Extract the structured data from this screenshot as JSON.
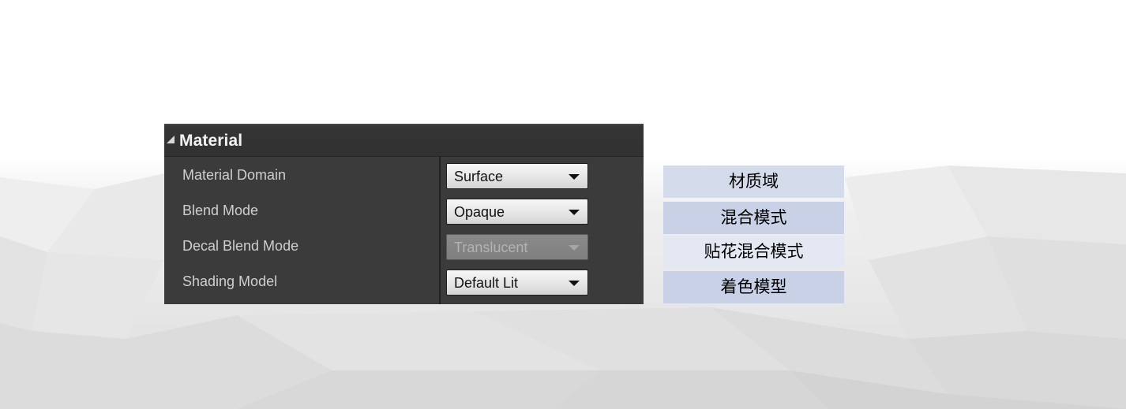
{
  "panel": {
    "title": "Material",
    "properties": [
      {
        "label": "Material Domain",
        "value": "Surface",
        "enabled": true
      },
      {
        "label": "Blend Mode",
        "value": "Opaque",
        "enabled": true
      },
      {
        "label": "Decal Blend Mode",
        "value": "Translucent",
        "enabled": false
      },
      {
        "label": "Shading Model",
        "value": "Default Lit",
        "enabled": true
      }
    ]
  },
  "translations": [
    "材质域",
    "混合模式",
    "贴花混合模式",
    "着色模型"
  ],
  "colors": {
    "panel_bg": "#3b3b3b",
    "header_bg": "#313131",
    "tag_bg": "#d4dbea"
  },
  "icons": {
    "collapse": "triangle-collapse-icon",
    "dropdown": "chevron-down-icon"
  }
}
